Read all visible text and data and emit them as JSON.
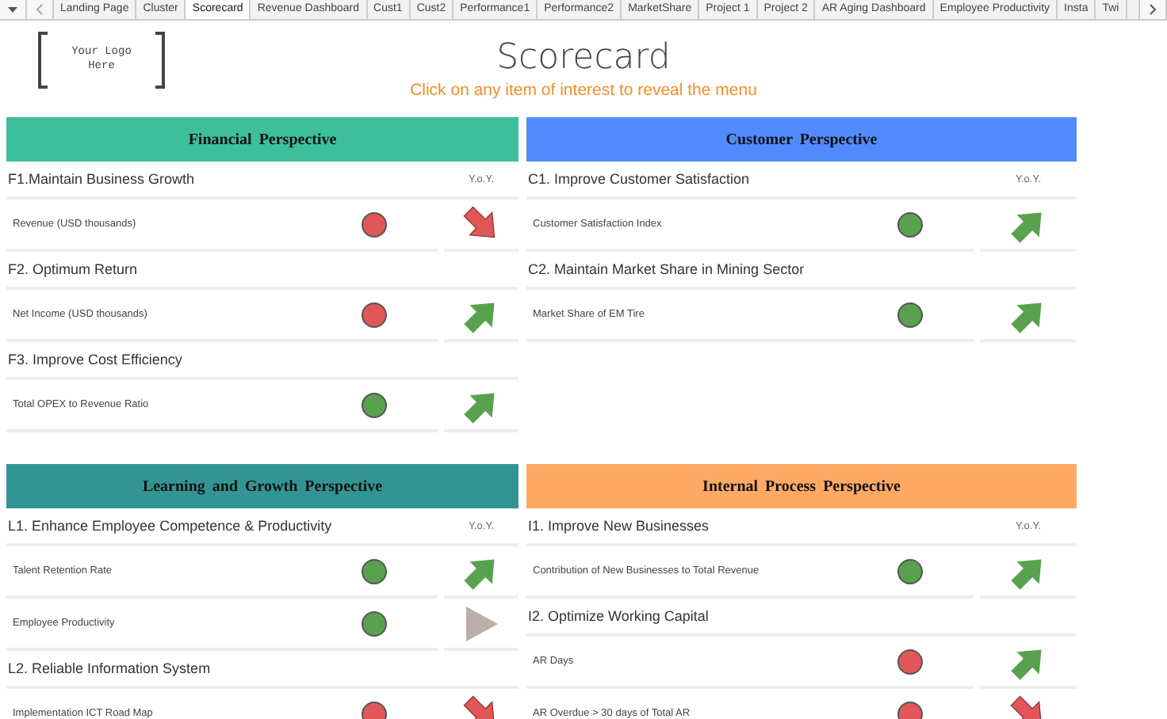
{
  "tabs": [
    {
      "label": "Landing Page",
      "selected": false
    },
    {
      "label": "Cluster",
      "selected": false
    },
    {
      "label": "Scorecard",
      "selected": true
    },
    {
      "label": "Revenue Dashboard",
      "selected": false
    },
    {
      "label": "Cust1",
      "selected": false
    },
    {
      "label": "Cust2",
      "selected": false
    },
    {
      "label": "Performance1",
      "selected": false
    },
    {
      "label": "Performance2",
      "selected": false
    },
    {
      "label": "MarketShare",
      "selected": false
    },
    {
      "label": "Project 1",
      "selected": false
    },
    {
      "label": "Project 2",
      "selected": false
    },
    {
      "label": "AR Aging Dashboard",
      "selected": false
    },
    {
      "label": "Employee Productivity",
      "selected": false
    },
    {
      "label": "Insta",
      "selected": false
    },
    {
      "label": "Twi",
      "selected": false
    }
  ],
  "logo": {
    "text": "Your Logo Here"
  },
  "title": "Scorecard",
  "subtitle": "Click on any item of interest to reveal the menu",
  "quadrants": [
    {
      "title": "Financial Perspective",
      "color": "#3dbf9c",
      "objectives": [
        {
          "title": "F1.Maintain Business Growth",
          "yoy": "Y.o.Y.",
          "measures": [
            {
              "name": "Revenue (USD thousands)",
              "color": "#e15759",
              "kind": "down"
            }
          ]
        },
        {
          "title": "F2. Optimum Return",
          "measures": [
            {
              "name": "Net Income (USD thousands)",
              "color": "#e15759",
              "kind": "up"
            }
          ]
        },
        {
          "title": "F3. Improve Cost Efficiency",
          "measures": [
            {
              "name": "Total OPEX to Revenue Ratio",
              "color": "#59a14f",
              "kind": "up"
            }
          ]
        }
      ]
    },
    {
      "title": "Customer Perspective",
      "color": "#528bff",
      "objectives": [
        {
          "title": "C1. Improve Customer Satisfaction",
          "yoy": "Y.o.Y.",
          "measures": [
            {
              "name": "Customer Satisfaction Index",
              "color": "#59a14f",
              "kind": "up"
            }
          ]
        },
        {
          "title": "C2. Maintain Market Share in Mining Sector",
          "measures": [
            {
              "name": "Market Share of EM Tire",
              "color": "#59a14f",
              "kind": "up"
            }
          ]
        }
      ]
    },
    {
      "title": "Learning and Growth Perspective",
      "color": "#339593",
      "objectives": [
        {
          "title": "L1. Enhance Employee Competence & Productivity",
          "yoy": "Y.o.Y.",
          "measures": [
            {
              "name": "Talent Retention Rate",
              "color": "#59a14f",
              "kind": "up"
            },
            {
              "name": "Employee Productivity",
              "color": "#59a14f",
              "kind": "flat"
            }
          ]
        },
        {
          "title": "L2. Reliable Information System",
          "measures": [
            {
              "name": "Implementation ICT Road Map",
              "color": "#e15759",
              "kind": "down"
            }
          ]
        }
      ]
    },
    {
      "title": "Internal Process Perspective",
      "color": "#ffa965",
      "objectives": [
        {
          "title": "I1. Improve New Businesses",
          "yoy": "Y.o.Y.",
          "measures": [
            {
              "name": "Contribution of New Businesses to Total Revenue",
              "color": "#59a14f",
              "kind": "up"
            }
          ]
        },
        {
          "title": "I2. Optimize Working Capital",
          "measures": [
            {
              "name": "AR Days",
              "color": "#e15759",
              "kind": "up"
            },
            {
              "name": "AR Overdue > 30 days of Total AR",
              "color": "#e15759",
              "kind": "down"
            }
          ]
        }
      ]
    }
  ]
}
